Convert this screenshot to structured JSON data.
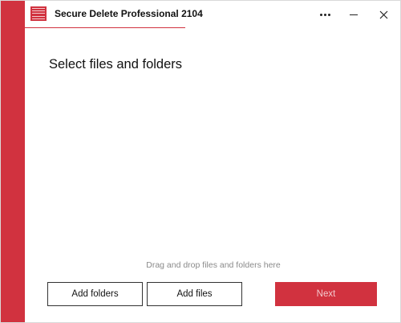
{
  "app": {
    "title": "Secure Delete Professional 2104"
  },
  "window_controls": {
    "more": "more-options",
    "minimize": "minimize",
    "close": "close"
  },
  "main": {
    "heading": "Select files and folders",
    "drop_hint": "Drag and drop files and folders here"
  },
  "actions": {
    "add_folders": "Add folders",
    "add_files": "Add files",
    "next": "Next",
    "next_enabled": false
  },
  "colors": {
    "accent": "#d1323f",
    "next_text_disabled": "#f3c9cd",
    "hint_text": "#8a8a8a"
  }
}
